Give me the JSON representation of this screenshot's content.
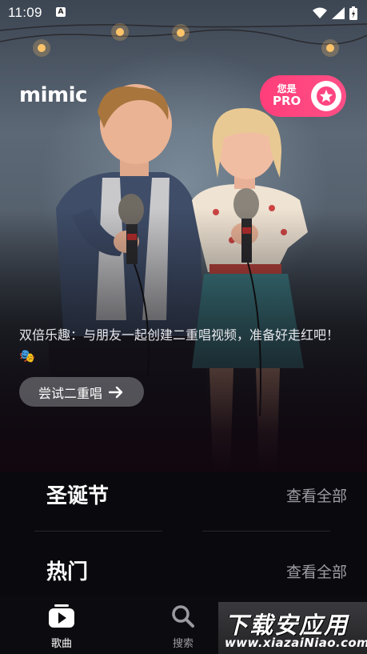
{
  "status_bar": {
    "time": "11:09",
    "notification_icon": "a-icon",
    "icons": [
      "wifi-icon",
      "signal-icon",
      "battery-icon"
    ]
  },
  "header": {
    "logo": "mimic",
    "pro_line1": "您是",
    "pro_line2": "PRO",
    "pro_icon": "star-icon",
    "accent_color": "#ff4581"
  },
  "hero": {
    "description": "双倍乐趣：与朋友一起创建二重唱视频，准备好走红吧！🎭",
    "cta_label": "尝试二重唱",
    "cta_icon": "arrow-right-icon"
  },
  "sections": [
    {
      "title": "圣诞节",
      "link": "查看全部"
    },
    {
      "title": "热门",
      "link": "查看全部"
    }
  ],
  "bottom_nav": {
    "items": [
      {
        "label": "歌曲",
        "icon": "play-icon",
        "active": true
      },
      {
        "label": "搜索",
        "icon": "search-icon",
        "active": false
      }
    ]
  },
  "watermark": {
    "title": "下载安应用",
    "url": "www.xiazaiNiao.com"
  }
}
